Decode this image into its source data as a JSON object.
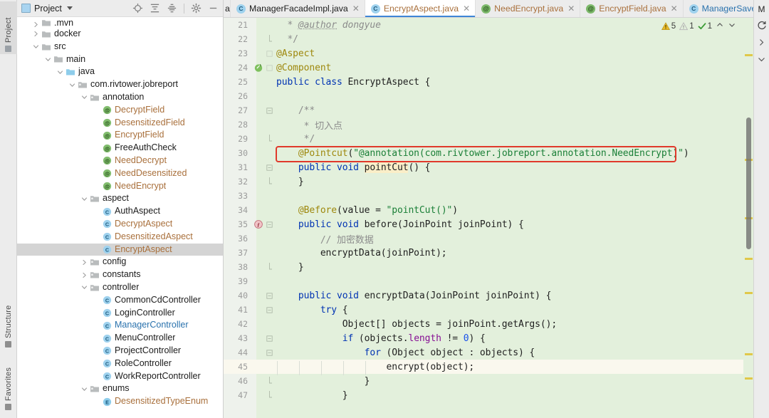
{
  "left_tool_strip": {
    "tabs": [
      {
        "label": "Project",
        "active": true
      },
      {
        "label": "Structure",
        "active": false
      },
      {
        "label": "Favorites",
        "active": false
      }
    ]
  },
  "project_panel": {
    "title": "Project",
    "toolbar": [
      {
        "name": "locate-icon",
        "tooltip": "Select Opened File"
      },
      {
        "name": "expand-all-icon",
        "tooltip": "Expand All"
      },
      {
        "name": "collapse-all-icon",
        "tooltip": "Collapse All"
      },
      {
        "name": "gear-icon",
        "tooltip": "Settings"
      },
      {
        "name": "minimize-icon",
        "tooltip": "Hide"
      }
    ],
    "tree": [
      {
        "label": ".mvn",
        "indent": 1,
        "arrow": "right",
        "icon": "folder",
        "color": "black",
        "clipped": true
      },
      {
        "label": "docker",
        "indent": 1,
        "arrow": "right",
        "icon": "folder",
        "color": "black"
      },
      {
        "label": "src",
        "indent": 1,
        "arrow": "down",
        "icon": "folder",
        "color": "black"
      },
      {
        "label": "main",
        "indent": 2,
        "arrow": "down",
        "icon": "folder",
        "color": "black"
      },
      {
        "label": "java",
        "indent": 3,
        "arrow": "down",
        "icon": "folder-source",
        "color": "black"
      },
      {
        "label": "com.rivtower.jobreport",
        "indent": 4,
        "arrow": "down",
        "icon": "package",
        "color": "black"
      },
      {
        "label": "annotation",
        "indent": 5,
        "arrow": "down",
        "icon": "package",
        "color": "black"
      },
      {
        "label": "DecryptField",
        "indent": 6,
        "arrow": "none",
        "icon": "annotation",
        "color": "brown"
      },
      {
        "label": "DesensitizedField",
        "indent": 6,
        "arrow": "none",
        "icon": "annotation",
        "color": "brown"
      },
      {
        "label": "EncryptField",
        "indent": 6,
        "arrow": "none",
        "icon": "annotation",
        "color": "brown"
      },
      {
        "label": "FreeAuthCheck",
        "indent": 6,
        "arrow": "none",
        "icon": "annotation",
        "color": "black"
      },
      {
        "label": "NeedDecrypt",
        "indent": 6,
        "arrow": "none",
        "icon": "annotation",
        "color": "brown"
      },
      {
        "label": "NeedDesensitized",
        "indent": 6,
        "arrow": "none",
        "icon": "annotation",
        "color": "brown"
      },
      {
        "label": "NeedEncrypt",
        "indent": 6,
        "arrow": "none",
        "icon": "annotation",
        "color": "brown"
      },
      {
        "label": "aspect",
        "indent": 5,
        "arrow": "down",
        "icon": "package",
        "color": "black"
      },
      {
        "label": "AuthAspect",
        "indent": 6,
        "arrow": "none",
        "icon": "class",
        "color": "black"
      },
      {
        "label": "DecryptAspect",
        "indent": 6,
        "arrow": "none",
        "icon": "class",
        "color": "brown"
      },
      {
        "label": "DesensitizedAspect",
        "indent": 6,
        "arrow": "none",
        "icon": "class",
        "color": "brown"
      },
      {
        "label": "EncryptAspect",
        "indent": 6,
        "arrow": "none",
        "icon": "class",
        "color": "brown",
        "selected": true
      },
      {
        "label": "config",
        "indent": 5,
        "arrow": "right",
        "icon": "package",
        "color": "black"
      },
      {
        "label": "constants",
        "indent": 5,
        "arrow": "right",
        "icon": "package",
        "color": "black"
      },
      {
        "label": "controller",
        "indent": 5,
        "arrow": "down",
        "icon": "package",
        "color": "black"
      },
      {
        "label": "CommonCdController",
        "indent": 6,
        "arrow": "none",
        "icon": "class",
        "color": "black"
      },
      {
        "label": "LoginController",
        "indent": 6,
        "arrow": "none",
        "icon": "class",
        "color": "black"
      },
      {
        "label": "ManagerController",
        "indent": 6,
        "arrow": "none",
        "icon": "class",
        "color": "blue"
      },
      {
        "label": "MenuController",
        "indent": 6,
        "arrow": "none",
        "icon": "class",
        "color": "black"
      },
      {
        "label": "ProjectController",
        "indent": 6,
        "arrow": "none",
        "icon": "class",
        "color": "black"
      },
      {
        "label": "RoleController",
        "indent": 6,
        "arrow": "none",
        "icon": "class",
        "color": "black"
      },
      {
        "label": "WorkReportController",
        "indent": 6,
        "arrow": "none",
        "icon": "class",
        "color": "black"
      },
      {
        "label": "enums",
        "indent": 5,
        "arrow": "down",
        "icon": "package",
        "color": "black"
      },
      {
        "label": "DesensitizedTypeEnum",
        "indent": 6,
        "arrow": "none",
        "icon": "enum",
        "color": "brown"
      }
    ]
  },
  "editor_tabs": {
    "left_clipped": {
      "label": "a",
      "badge": "none"
    },
    "items": [
      {
        "label": "ManagerFacadeImpl.java",
        "badge": "class",
        "color": "black",
        "active": false
      },
      {
        "label": "EncryptAspect.java",
        "badge": "class",
        "color": "brown",
        "active": true
      },
      {
        "label": "NeedEncrypt.java",
        "badge": "annotation",
        "color": "brown",
        "active": false
      },
      {
        "label": "EncryptField.java",
        "badge": "annotation",
        "color": "brown",
        "active": false
      },
      {
        "label": "ManagerSaveReq.java",
        "badge": "class",
        "color": "blue",
        "active": false
      }
    ],
    "overflow_icon": "chevron-down-icon",
    "trailing_label": "M"
  },
  "inspections": {
    "warnings_icon": "warning-triangle-icon",
    "warnings": "5",
    "weak_warnings_icon": "weak-warning-triangle-icon",
    "weak_warnings": "1",
    "ok_icon": "green-check-icon",
    "ok_count": "1",
    "prev_icon": "chevron-up-icon",
    "next_icon": "chevron-down-icon"
  },
  "right_tool_strip": {
    "items": [
      {
        "name": "refresh-icon"
      },
      {
        "name": "chevron-right-icon"
      },
      {
        "name": "chevron-down-icon"
      }
    ]
  },
  "code": {
    "file": "EncryptAspect.java",
    "caret_line": 45,
    "highlight_line": 30,
    "lines": [
      {
        "n": 21,
        "fold": "",
        "gutter": "",
        "tokens": [
          {
            "t": "  * ",
            "c": "cmt"
          },
          {
            "t": "@author",
            "c": "lnk"
          },
          {
            "t": " dongyue",
            "c": "cmt"
          }
        ]
      },
      {
        "n": 22,
        "fold": "end",
        "gutter": "",
        "tokens": [
          {
            "t": "  */",
            "c": "cmt2"
          }
        ]
      },
      {
        "n": 23,
        "fold": "tick",
        "gutter": "",
        "tokens": [
          {
            "t": "@Aspect",
            "c": "anno"
          }
        ]
      },
      {
        "n": 24,
        "fold": "tick",
        "gutter": "spring-bean-icon",
        "tokens": [
          {
            "t": "@Component",
            "c": "anno"
          }
        ]
      },
      {
        "n": 25,
        "fold": "",
        "gutter": "",
        "tokens": [
          {
            "t": "public class ",
            "c": "kw"
          },
          {
            "t": "EncryptAspect {",
            "c": "id"
          }
        ]
      },
      {
        "n": 26,
        "fold": "",
        "gutter": "",
        "tokens": [
          {
            "t": "",
            "c": "id"
          }
        ]
      },
      {
        "n": 27,
        "fold": "start",
        "gutter": "",
        "tokens": [
          {
            "t": "    /**",
            "c": "cmt2"
          }
        ]
      },
      {
        "n": 28,
        "fold": "",
        "gutter": "",
        "tokens": [
          {
            "t": "     * 切入点",
            "c": "cmt2"
          }
        ]
      },
      {
        "n": 29,
        "fold": "end",
        "gutter": "",
        "tokens": [
          {
            "t": "     */",
            "c": "cmt2"
          }
        ]
      },
      {
        "n": 30,
        "fold": "",
        "gutter": "",
        "tokens": [
          {
            "t": "    @Pointcut",
            "c": "anno"
          },
          {
            "t": "(",
            "c": "id"
          },
          {
            "t": "\"@annotation",
            "c": "str"
          },
          {
            "t": "(com.rivtower.jobreport.annotation.NeedEncrypt)\"",
            "c": "str2"
          },
          {
            "t": ")",
            "c": "id"
          }
        ]
      },
      {
        "n": 31,
        "fold": "start",
        "gutter": "",
        "tokens": [
          {
            "t": "    public void ",
            "c": "kw"
          },
          {
            "t": "pointCut",
            "c": "mhl"
          },
          {
            "t": "() {",
            "c": "id"
          }
        ]
      },
      {
        "n": 32,
        "fold": "end",
        "gutter": "",
        "tokens": [
          {
            "t": "    }",
            "c": "id"
          }
        ]
      },
      {
        "n": 33,
        "fold": "",
        "gutter": "",
        "tokens": [
          {
            "t": "",
            "c": "id"
          }
        ]
      },
      {
        "n": 34,
        "fold": "",
        "gutter": "",
        "tokens": [
          {
            "t": "    @Before",
            "c": "anno"
          },
          {
            "t": "(value = ",
            "c": "id"
          },
          {
            "t": "\"pointCut()\"",
            "c": "str"
          },
          {
            "t": ")",
            "c": "id"
          }
        ]
      },
      {
        "n": 35,
        "fold": "start",
        "gutter": "aop-advice-icon",
        "tokens": [
          {
            "t": "    public void ",
            "c": "kw"
          },
          {
            "t": "before",
            "c": "meth"
          },
          {
            "t": "(JoinPoint joinPoint) {",
            "c": "id"
          }
        ]
      },
      {
        "n": 36,
        "fold": "",
        "gutter": "",
        "tokens": [
          {
            "t": "        // 加密数据",
            "c": "cmt2"
          }
        ]
      },
      {
        "n": 37,
        "fold": "",
        "gutter": "",
        "tokens": [
          {
            "t": "        encryptData(joinPoint);",
            "c": "id"
          }
        ]
      },
      {
        "n": 38,
        "fold": "end",
        "gutter": "",
        "tokens": [
          {
            "t": "    }",
            "c": "id"
          }
        ]
      },
      {
        "n": 39,
        "fold": "",
        "gutter": "",
        "tokens": [
          {
            "t": "",
            "c": "id"
          }
        ]
      },
      {
        "n": 40,
        "fold": "start",
        "gutter": "",
        "tokens": [
          {
            "t": "    public void ",
            "c": "kw"
          },
          {
            "t": "encryptData",
            "c": "meth"
          },
          {
            "t": "(JoinPoint joinPoint) {",
            "c": "id"
          }
        ]
      },
      {
        "n": 41,
        "fold": "start",
        "gutter": "",
        "tokens": [
          {
            "t": "        try",
            "c": "kw"
          },
          {
            "t": " {",
            "c": "id"
          }
        ]
      },
      {
        "n": 42,
        "fold": "",
        "gutter": "",
        "tokens": [
          {
            "t": "            Object[] objects = joinPoint.getArgs();",
            "c": "id"
          }
        ]
      },
      {
        "n": 43,
        "fold": "start",
        "gutter": "",
        "tokens": [
          {
            "t": "            if",
            "c": "kw"
          },
          {
            "t": " (objects.",
            "c": "id"
          },
          {
            "t": "length",
            "c": "fld"
          },
          {
            "t": " != ",
            "c": "id"
          },
          {
            "t": "0",
            "c": "num"
          },
          {
            "t": ") {",
            "c": "id"
          }
        ]
      },
      {
        "n": 44,
        "fold": "start",
        "gutter": "",
        "tokens": [
          {
            "t": "                for",
            "c": "kw"
          },
          {
            "t": " (Object object : objects) {",
            "c": "id"
          }
        ]
      },
      {
        "n": 45,
        "fold": "",
        "gutter": "",
        "tokens": [
          {
            "t": "                    encrypt(object);",
            "c": "id"
          }
        ]
      },
      {
        "n": 46,
        "fold": "end",
        "gutter": "",
        "tokens": [
          {
            "t": "                }",
            "c": "id"
          }
        ]
      },
      {
        "n": 47,
        "fold": "end",
        "gutter": "",
        "tokens": [
          {
            "t": "            }",
            "c": "id"
          }
        ]
      }
    ]
  },
  "colors": {
    "editor_bg_modified": "#e3f0dc",
    "caret_row": "#faf8ee",
    "highlight_box": "#e0392b",
    "tab_active_underline": "#3e86d6",
    "vcs_modified_text": "#a9703c",
    "open_file_text": "#2a72ad"
  }
}
